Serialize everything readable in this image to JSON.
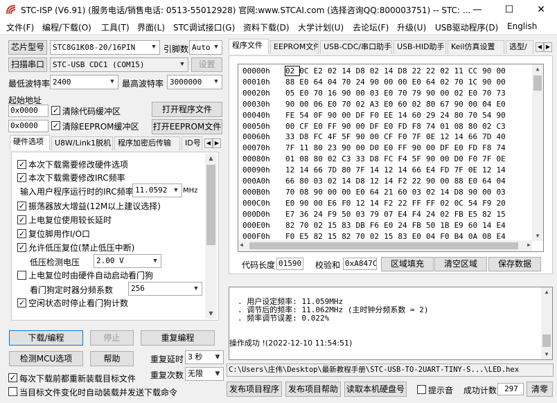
{
  "window": {
    "title": "STC-ISP (V6.91) (服务电话/销售电话: 0513-55012928) 官网:www.STCAI.com  (选择咨询QQ:800003751) -- STC: ...",
    "minimize": "—",
    "maximize": "☐",
    "close": "✕"
  },
  "menu": [
    "文件(F)",
    "编程/下载(O)",
    "工具(T)",
    "界面(L)",
    "STC调试接口(G)",
    "资料下载(D)",
    "大学计划(U)",
    "去论坛(F)",
    "升级(U)",
    "USB驱动程序(D)",
    "English"
  ],
  "left": {
    "chip_button": "芯片型号",
    "chip_value": "STC8G1K08-20/16PIN",
    "pin_label": "引脚数",
    "pin_value": "Auto",
    "scan_button": "扫描串口",
    "port_value": "STC-USB CDC1 (COM15)",
    "settings_button": "设置",
    "min_baud_label": "最低波特率",
    "min_baud_value": "2400",
    "max_baud_label": "最高波特率",
    "max_baud_value": "3000000",
    "start_addr_label": "起始地址",
    "code_addr": "0x0000",
    "clear_code_label": "清除代码缓冲区",
    "open_program_button": "打开程序文件",
    "eeprom_addr": "0x0000",
    "clear_eeprom_label": "清除EEPROM缓冲区",
    "open_eeprom_button": "打开EEPROM文件",
    "tabs": [
      "硬件选项",
      "U8W/Link1脱机",
      "程序加密后传输",
      "ID号"
    ],
    "options": {
      "opt1": "本次下载需要修改硬件选项",
      "opt2": "本次下载需要修改IRC频率",
      "irc_label": "输入用户程序运行时的IRC频率",
      "irc_value": "11.0592",
      "irc_unit": "MHz",
      "opt3": "振荡器放大增益(12M以上建议选择)",
      "opt4": "上电复位使用较长延时",
      "opt5": "复位脚用作I/O口",
      "opt6": "允许低压复位(禁止低压中断)",
      "lv_label": "低压检测电压",
      "lv_value": "2.00 V",
      "opt7": "上电复位时由硬件自动启动看门狗",
      "wdt_label": "看门狗定时器分频系数",
      "wdt_value": "256",
      "opt8": "空闲状态时停止看门狗计数"
    },
    "download_button": "下载/编程",
    "stop_button": "停止",
    "reprogram_button": "重复编程",
    "check_mcu_button": "检测MCU选项",
    "help_button": "帮助",
    "repeat_delay_label": "重复延时",
    "repeat_delay_value": "3 秒",
    "repeat_count_label": "重复次数",
    "repeat_count_value": "无限",
    "reload_label": "每次下载前都重新装载目标文件",
    "auto_send_label": "当目标文件变化时自动装载并发送下载命令"
  },
  "right": {
    "tabs": [
      "程序文件",
      "EEPROM文件",
      "USB-CDC/串口助手",
      "USB-HID助手",
      "Keil仿真设置",
      "选型/"
    ],
    "hex_rows": [
      {
        "addr": "00000h",
        "bytes": [
          "02",
          "0C",
          "E2",
          "02",
          "14",
          "D8",
          "02",
          "14",
          "D8",
          "22",
          "22",
          "02",
          "11",
          "CC",
          "90",
          "00"
        ]
      },
      {
        "addr": "00010h",
        "bytes": [
          "88",
          "E0",
          "64",
          "04",
          "70",
          "24",
          "90",
          "00",
          "00",
          "E0",
          "64",
          "02",
          "70",
          "1C",
          "90",
          "00"
        ]
      },
      {
        "addr": "00020h",
        "bytes": [
          "05",
          "E0",
          "70",
          "16",
          "90",
          "00",
          "03",
          "E0",
          "70",
          "79",
          "90",
          "00",
          "02",
          "E0",
          "70",
          "73"
        ]
      },
      {
        "addr": "00030h",
        "bytes": [
          "90",
          "00",
          "06",
          "E0",
          "70",
          "02",
          "A3",
          "E0",
          "60",
          "02",
          "80",
          "67",
          "90",
          "00",
          "04",
          "E0"
        ]
      },
      {
        "addr": "00040h",
        "bytes": [
          "FE",
          "54",
          "0F",
          "90",
          "00",
          "DF",
          "F0",
          "EE",
          "14",
          "60",
          "29",
          "24",
          "80",
          "70",
          "54",
          "90"
        ]
      },
      {
        "addr": "00050h",
        "bytes": [
          "00",
          "CF",
          "E0",
          "FF",
          "90",
          "00",
          "DF",
          "E0",
          "FD",
          "F8",
          "74",
          "01",
          "08",
          "80",
          "02",
          "C3"
        ]
      },
      {
        "addr": "00060h",
        "bytes": [
          "33",
          "D8",
          "FC",
          "4F",
          "5F",
          "90",
          "00",
          "CF",
          "F0",
          "7F",
          "0E",
          "12",
          "14",
          "66",
          "7D",
          "40"
        ]
      },
      {
        "addr": "00070h",
        "bytes": [
          "7F",
          "11",
          "80",
          "23",
          "90",
          "00",
          "D0",
          "E0",
          "FF",
          "90",
          "00",
          "DF",
          "E0",
          "FD",
          "F8",
          "74"
        ]
      },
      {
        "addr": "00080h",
        "bytes": [
          "01",
          "08",
          "80",
          "02",
          "C3",
          "33",
          "D8",
          "FC",
          "F4",
          "5F",
          "90",
          "00",
          "D0",
          "F0",
          "7F",
          "0E"
        ]
      },
      {
        "addr": "00090h",
        "bytes": [
          "12",
          "14",
          "66",
          "7D",
          "80",
          "7F",
          "14",
          "12",
          "14",
          "66",
          "E4",
          "FD",
          "7F",
          "0E",
          "12",
          "14"
        ]
      },
      {
        "addr": "000A0h",
        "bytes": [
          "66",
          "80",
          "03",
          "02",
          "14",
          "D8",
          "12",
          "14",
          "F2",
          "22",
          "90",
          "00",
          "88",
          "E0",
          "64",
          "04"
        ]
      },
      {
        "addr": "000B0h",
        "bytes": [
          "70",
          "08",
          "90",
          "00",
          "00",
          "E0",
          "64",
          "21",
          "60",
          "03",
          "02",
          "14",
          "D8",
          "90",
          "00",
          "03"
        ]
      },
      {
        "addr": "000C0h",
        "bytes": [
          "E0",
          "90",
          "00",
          "E6",
          "F0",
          "12",
          "14",
          "F2",
          "22",
          "FF",
          "FF",
          "02",
          "0C",
          "54",
          "F9",
          "20"
        ]
      },
      {
        "addr": "000D0h",
        "bytes": [
          "E7",
          "36",
          "24",
          "F9",
          "50",
          "03",
          "79",
          "07",
          "E4",
          "F4",
          "24",
          "02",
          "FB",
          "E5",
          "82",
          "15"
        ]
      },
      {
        "addr": "000E0h",
        "bytes": [
          "82",
          "70",
          "02",
          "15",
          "83",
          "DB",
          "F6",
          "E0",
          "24",
          "FB",
          "50",
          "1B",
          "E9",
          "60",
          "14",
          "E4"
        ]
      },
      {
        "addr": "000F0h",
        "bytes": [
          "F0",
          "E5",
          "82",
          "15",
          "82",
          "70",
          "02",
          "15",
          "83",
          "E0",
          "04",
          "F0",
          "B4",
          "0A",
          "08",
          "E4"
        ]
      }
    ],
    "code_len_label": "代码长度",
    "code_len_value": "01590",
    "checksum_label": "校验和",
    "checksum_value": "0xA847C",
    "fill_button": "区域填充",
    "clear_button": "清空区域",
    "save_button": "保存数据",
    "log_lines": [
      ". 用户设定频率: 11.059MHz",
      ". 调节后的频率: 11.062MHz (主时钟分频系数 = 2)",
      ". 频率调节误差: 0.022%"
    ],
    "log_result": "操作成功 !(2022-12-10 11:54:51)",
    "file_path": "C:\\Users\\庄伟\\Desktop\\最新教程手册\\STC-USB-TO-2UART-TINY-S...\\LED.hex",
    "publish_button": "发布项目程序",
    "publish_help_button": "发布项目帮助",
    "read_disk_button": "读取本机硬盘号",
    "beep_label": "提示音",
    "success_count_label": "成功计数",
    "success_count_value": "297",
    "clear_count_button": "清零"
  }
}
